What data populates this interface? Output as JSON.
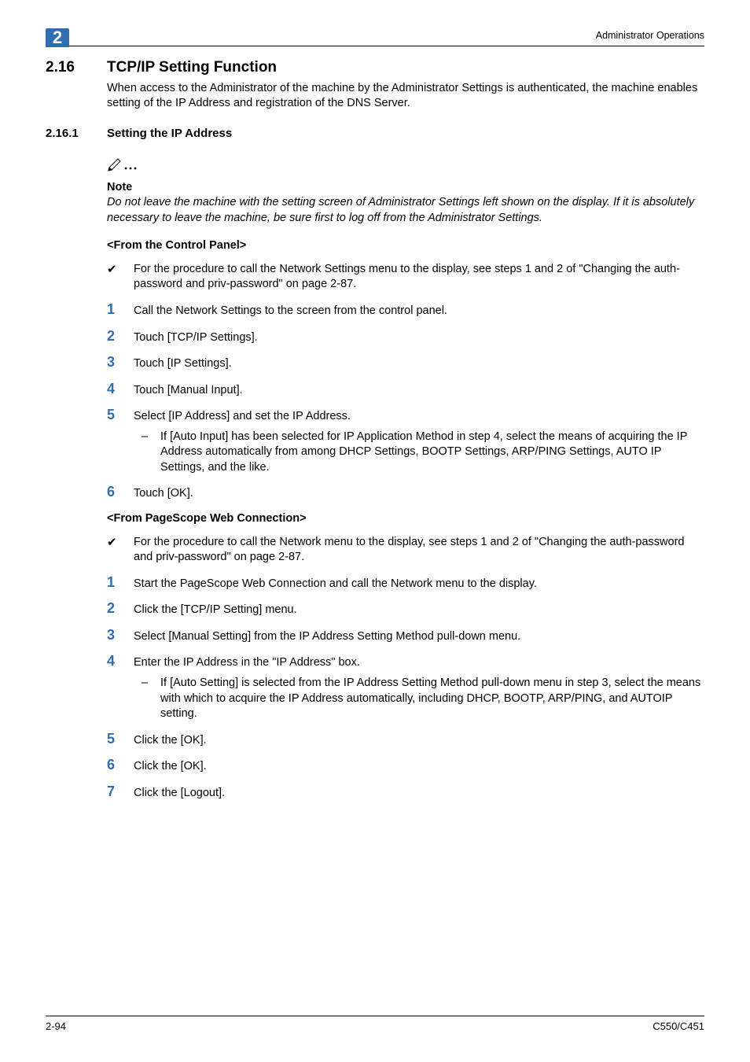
{
  "header": {
    "chapter": "2",
    "right": "Administrator Operations"
  },
  "h2": {
    "num": "2.16",
    "title": "TCP/IP Setting Function"
  },
  "intro": "When access to the Administrator of the machine by the Administrator Settings is authenticated, the machine enables setting of the IP Address and registration of the DNS Server.",
  "h3": {
    "num": "2.16.1",
    "title": "Setting the IP Address"
  },
  "note": {
    "label": "Note",
    "body": "Do not leave the machine with the setting screen of Administrator Settings left shown on the display. If it is absolutely necessary to leave the machine, be sure first to log off from the Administrator Settings."
  },
  "section_a": {
    "heading": "<From the Control Panel>",
    "pre": "For the procedure to call the Network Settings menu to the display, see steps 1 and 2 of \"Changing the auth-password and priv-password\" on page 2-87.",
    "steps": {
      "s1": "Call the Network Settings to the screen from the control panel.",
      "s2": "Touch [TCP/IP Settings].",
      "s3": "Touch [IP Settings].",
      "s4": "Touch [Manual Input].",
      "s5": "Select [IP Address] and set the IP Address.",
      "s5_sub": "If [Auto Input] has been selected for IP Application Method in step 4, select the means of acquiring the IP Address automatically from among DHCP Settings, BOOTP Settings, ARP/PING Settings, AUTO IP Settings, and the like.",
      "s6": "Touch [OK]."
    }
  },
  "section_b": {
    "heading": "<From PageScope Web Connection>",
    "pre": "For the procedure to call the Network menu to the display, see steps 1 and 2 of \"Changing the auth-password and priv-password\" on page 2-87.",
    "steps": {
      "s1": "Start the PageScope Web Connection and call the Network menu to the display.",
      "s2": "Click the [TCP/IP Setting] menu.",
      "s3": "Select [Manual Setting] from the IP Address Setting Method pull-down menu.",
      "s4": "Enter the IP Address in the \"IP Address\" box.",
      "s4_sub": "If [Auto Setting] is selected from the IP Address Setting Method pull-down menu in step 3, select the means with which to acquire the IP Address automatically, including DHCP, BOOTP, ARP/PING, and AUTOIP setting.",
      "s5": "Click the [OK].",
      "s6": "Click the [OK].",
      "s7": "Click the [Logout]."
    }
  },
  "footer": {
    "left": "2-94",
    "right": "C550/C451"
  }
}
